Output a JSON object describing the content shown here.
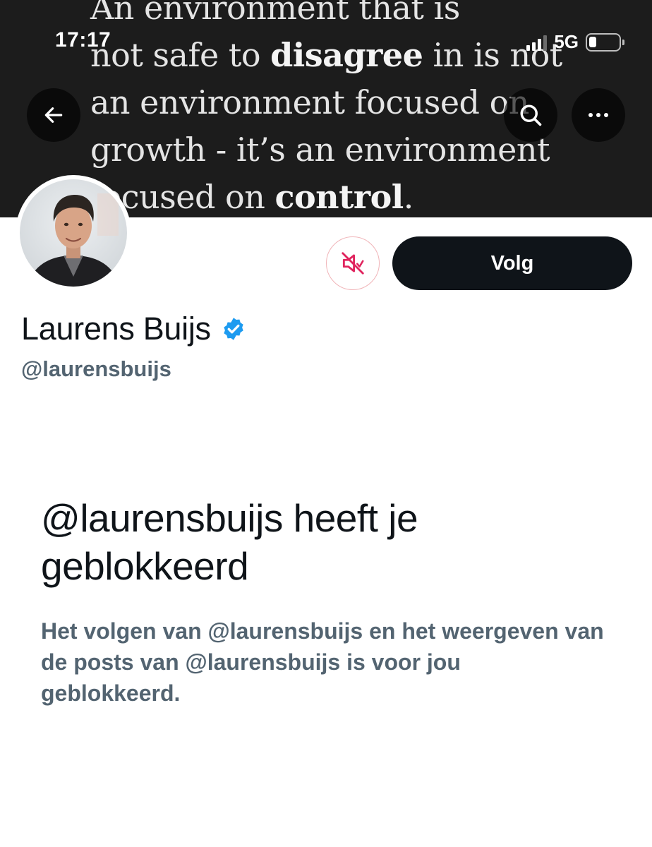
{
  "status_bar": {
    "time": "17:17",
    "network": "5G",
    "signal_bars_active": 3,
    "signal_bars_total": 4,
    "battery_level_percent": 20
  },
  "banner": {
    "quote_lines": [
      "An environment that is",
      "not safe to ",
      "disagree",
      " in is not",
      "an environment focused on",
      "growth - it’s an environment",
      "focused on ",
      "control",
      "."
    ]
  },
  "header_buttons": {
    "back_icon": "arrow-left-icon",
    "search_icon": "search-icon",
    "more_icon": "more-dots-icon"
  },
  "profile": {
    "display_name": "Laurens Buijs",
    "verified": true,
    "handle": "@laurensbuijs",
    "mute_icon": "muted-speaker-icon",
    "follow_label": "Volg"
  },
  "blocked": {
    "title": "@laurensbuijs heeft je geblokkeerd",
    "description": "Het volgen van @laurensbuijs en het weergeven van de posts van @laurensbuijs is voor jou geblokkeerd."
  },
  "colors": {
    "accent_verified": "#1d9bf0",
    "follow_button_bg": "#0f1419",
    "muted_red": "#e0245e",
    "secondary_text": "#536471"
  }
}
